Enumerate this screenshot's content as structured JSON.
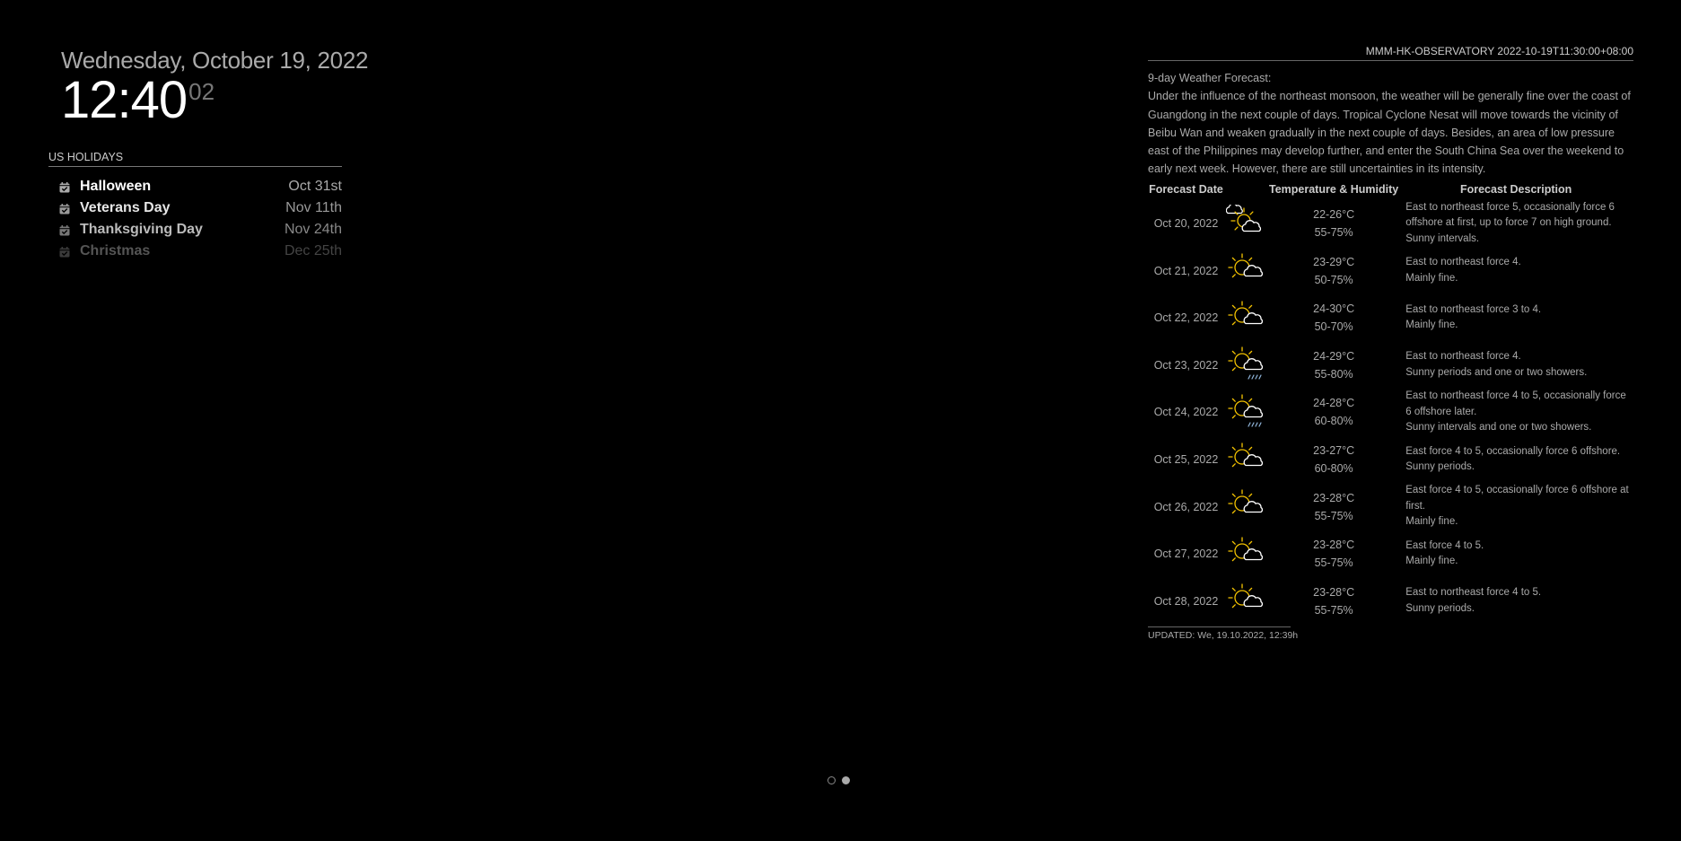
{
  "clock": {
    "date": "Wednesday, October 19, 2022",
    "hours_minutes": "12:40",
    "seconds": "02"
  },
  "calendar": {
    "header": "US HOLIDAYS",
    "icon": "calendar-check-icon",
    "events": [
      {
        "title": "Halloween",
        "when": "Oct 31st"
      },
      {
        "title": "Veterans Day",
        "when": "Nov 11th"
      },
      {
        "title": "Thanksgiving Day",
        "when": "Nov 24th"
      },
      {
        "title": "Christmas",
        "when": "Dec 25th"
      }
    ]
  },
  "weather": {
    "header": "MMM-HK-OBSERVATORY 2022-10-19T11:30:00+08:00",
    "summary_title": "9-day Weather Forecast:",
    "summary": "Under the influence of the northeast monsoon, the weather will be generally fine over the coast of Guangdong in the next couple of days. Tropical Cyclone Nesat will move towards the vicinity of Beibu Wan and weaken gradually in the next couple of days. Besides, an area of low pressure east of the Philippines may develop further, and enter the South China Sea over the weekend to early next week. However, there are still uncertainties in its intensity.",
    "columns": {
      "date": "Forecast Date",
      "temp": "Temperature & Humidity",
      "desc": "Forecast Description"
    },
    "forecast": [
      {
        "date": "Oct 20, 2022",
        "icon": "sunny-intervals-icon",
        "temp": "22-26°C",
        "humidity": "55-75%",
        "wind": "East to northeast force 5, occasionally force 6 offshore at first, up to force 7 on high ground.",
        "weather": "Sunny intervals."
      },
      {
        "date": "Oct 21, 2022",
        "icon": "mainly-fine-icon",
        "temp": "23-29°C",
        "humidity": "50-75%",
        "wind": "East to northeast force 4.",
        "weather": "Mainly fine."
      },
      {
        "date": "Oct 22, 2022",
        "icon": "mainly-fine-icon",
        "temp": "24-30°C",
        "humidity": "50-70%",
        "wind": "East to northeast force 3 to 4.",
        "weather": "Mainly fine."
      },
      {
        "date": "Oct 23, 2022",
        "icon": "sunny-showers-icon",
        "temp": "24-29°C",
        "humidity": "55-80%",
        "wind": "East to northeast force 4.",
        "weather": "Sunny periods and one or two showers."
      },
      {
        "date": "Oct 24, 2022",
        "icon": "sunny-intervals-showers-icon",
        "temp": "24-28°C",
        "humidity": "60-80%",
        "wind": "East to northeast force 4 to 5, occasionally force 6 offshore later.",
        "weather": "Sunny intervals and one or two showers."
      },
      {
        "date": "Oct 25, 2022",
        "icon": "sunny-periods-icon",
        "temp": "23-27°C",
        "humidity": "60-80%",
        "wind": "East force 4 to 5, occasionally force 6 offshore.",
        "weather": "Sunny periods."
      },
      {
        "date": "Oct 26, 2022",
        "icon": "mainly-fine-icon",
        "temp": "23-28°C",
        "humidity": "55-75%",
        "wind": "East force 4 to 5, occasionally force 6 offshore at first.",
        "weather": "Mainly fine."
      },
      {
        "date": "Oct 27, 2022",
        "icon": "mainly-fine-icon",
        "temp": "23-28°C",
        "humidity": "55-75%",
        "wind": "East force 4 to 5.",
        "weather": "Mainly fine."
      },
      {
        "date": "Oct 28, 2022",
        "icon": "sunny-periods-icon",
        "temp": "23-28°C",
        "humidity": "55-75%",
        "wind": "East to northeast force 4 to 5.",
        "weather": "Sunny periods."
      }
    ],
    "updated": "UPDATED: We, 19.10.2022, 12:39h"
  },
  "pages": {
    "count": 2,
    "active_index": 1
  },
  "colors": {
    "background": "#000000",
    "sun": "#f5c400",
    "cloud": "#ffffff",
    "rain": "#8fb4d9"
  }
}
